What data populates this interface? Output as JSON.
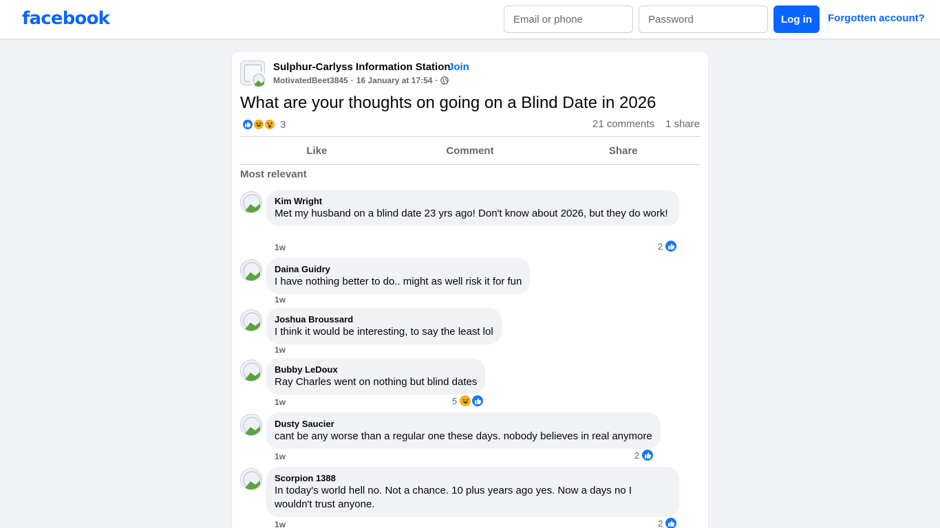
{
  "header": {
    "logo": "facebook",
    "email_placeholder": "Email or phone",
    "password_placeholder": "Password",
    "login_label": "Log in",
    "forgot_label": "Forgotten account?"
  },
  "post": {
    "group_name": "Sulphur-Carlyss Information Station",
    "separator": "·",
    "join_label": "Join",
    "author": "MotivatedBeet3845",
    "date": "16 January at 17:54",
    "title": "What are your thoughts on going on a Blind Date in 2026",
    "reaction_count": "3",
    "reaction_types": [
      "like",
      "haha",
      "wow"
    ],
    "comments_count": "21 comments",
    "shares_count": "1 share"
  },
  "actions": {
    "like": "Like",
    "comment": "Comment",
    "share": "Share"
  },
  "comments_section": {
    "filter_label": "Most relevant"
  },
  "comments": [
    {
      "name": "Kim Wright",
      "text": "Met my husband on a blind date 23 yrs ago! Don't know about 2026, but they do work!",
      "time": "1w",
      "reactions": "2"
    },
    {
      "name": "Daina Guidry",
      "text": "I have nothing better to do.. might as well risk it for fun",
      "time": "1w",
      "reactions": ""
    },
    {
      "name": "Joshua Broussard",
      "text": "I think it would be interesting, to say the least lol",
      "time": "1w",
      "reactions": ""
    },
    {
      "name": "Bubby LeDoux",
      "text": "Ray Charles went on nothing but blind dates",
      "time": "1w",
      "reactions": "5"
    },
    {
      "name": "Dusty Saucier",
      "text": "cant be any worse than a regular one these days. nobody believes in real anymore",
      "time": "1w",
      "reactions": "2"
    },
    {
      "name": "Scorpion 1388",
      "text": "In today's world hell no. Not a chance. 10 plus years ago yes. Now a days no I wouldn't trust anyone.",
      "time": "1w",
      "reactions": "2"
    }
  ],
  "colors": {
    "brand": "#0866ff",
    "like": "#1877f2",
    "emoji": "#f7b125",
    "secondary_text": "#65676b"
  }
}
